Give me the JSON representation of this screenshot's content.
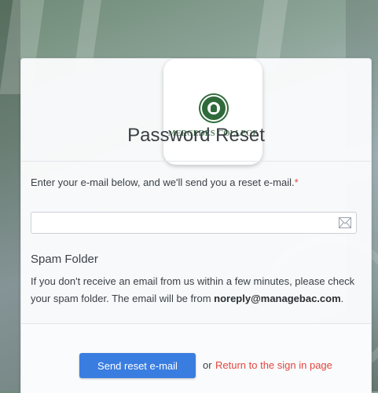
{
  "logo": {
    "name": "MERCEDES COLLEGE"
  },
  "page": {
    "title": "Password Reset"
  },
  "form": {
    "email_label": "Enter your e-mail below, and we'll send you a reset e-mail.",
    "required_mark": "*",
    "email_value": "",
    "email_icon": "envelope-icon"
  },
  "spam": {
    "title": "Spam Folder",
    "text_before": "If you don't receive an email from us within a few minutes, please check your spam folder. The email will be from ",
    "email": "noreply@managebac.com",
    "text_after": "."
  },
  "actions": {
    "send_label": "Send reset e-mail",
    "or_label": "or",
    "return_label": "Return to the sign in page"
  },
  "colors": {
    "primary": "#3a7de0",
    "link": "#e2473f",
    "brand_green": "#2f6b3a"
  }
}
